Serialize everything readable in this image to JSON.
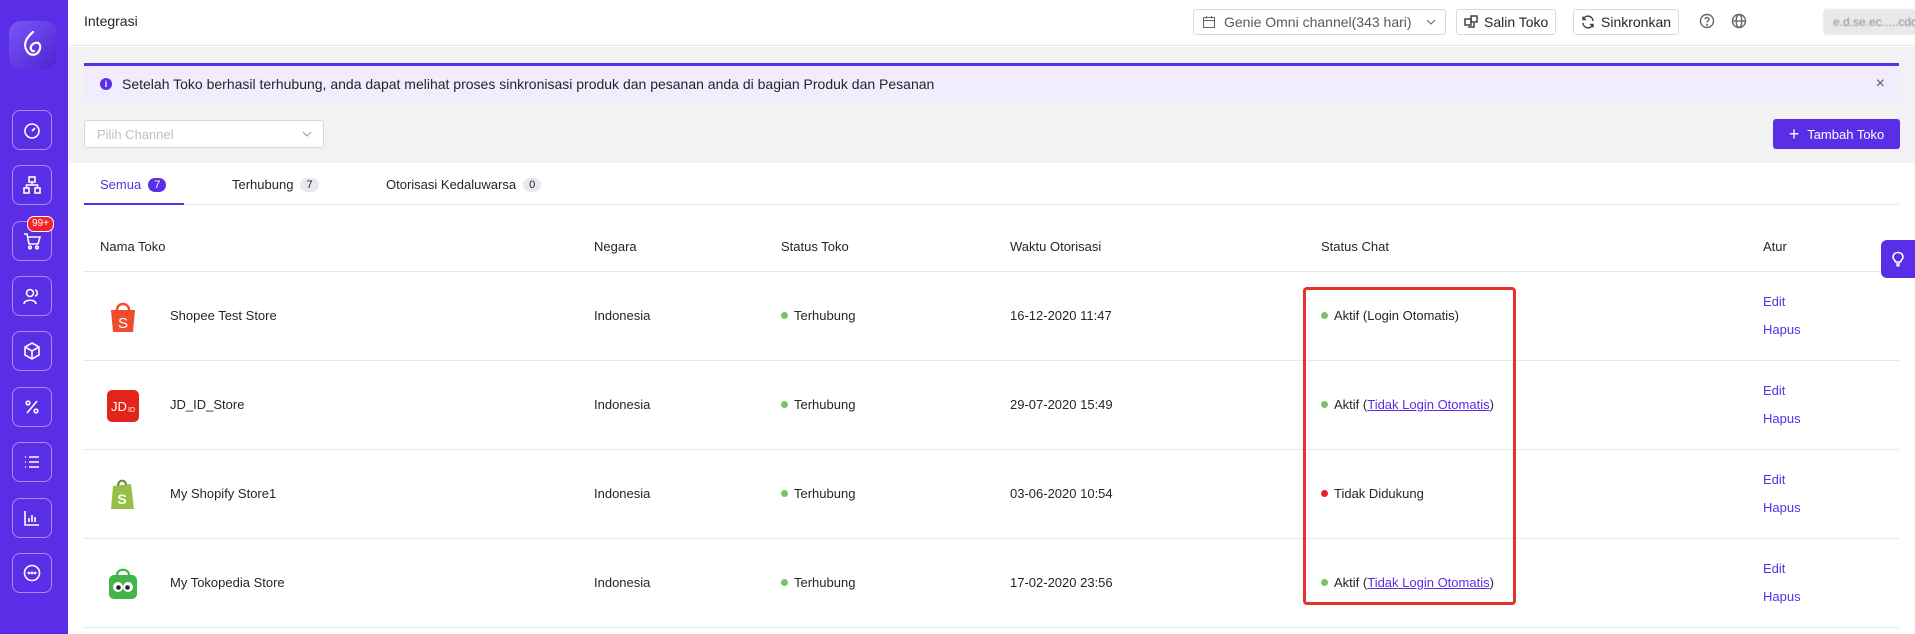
{
  "header": {
    "title": "Integrasi",
    "store_select": "Genie Omni channel(343 hari)",
    "copy_button": "Salin Toko",
    "sync_button": "Sinkronkan",
    "user": "e.d.se.ec.....cdc"
  },
  "sidebar": {
    "cart_badge": "99+",
    "items": [
      "dashboard-icon",
      "org-chart-icon",
      "cart-icon",
      "users-icon",
      "box-icon",
      "percent-icon",
      "list-icon",
      "bar-chart-icon",
      "chat-icon"
    ]
  },
  "alert": {
    "text": "Setelah Toko berhasil terhubung, anda dapat melihat proses sinkronisasi produk dan pesanan anda di bagian Produk dan Pesanan",
    "close": "×"
  },
  "filter": {
    "channel_placeholder": "Pilih Channel",
    "add_button": "Tambah Toko",
    "add_icon": "+"
  },
  "tabs": [
    {
      "label": "Semua",
      "count": "7"
    },
    {
      "label": "Terhubung",
      "count": "7"
    },
    {
      "label": "Otorisasi Kedaluwarsa",
      "count": "0"
    }
  ],
  "table": {
    "columns": [
      "Nama Toko",
      "Negara",
      "Status Toko",
      "Waktu Otorisasi",
      "Status Chat",
      "Atur"
    ],
    "rows": [
      {
        "name": "Shopee Test Store",
        "country": "Indonesia",
        "status": "Terhubung",
        "auth_time": "16-12-2020 11:47",
        "chat_status": "Aktif (Login Otomatis)",
        "chat_link": "",
        "chat_color": "green",
        "edit": "Edit",
        "delete": "Hapus"
      },
      {
        "name": "JD_ID_Store",
        "country": "Indonesia",
        "status": "Terhubung",
        "auth_time": "29-07-2020 15:49",
        "chat_status": "Aktif (",
        "chat_link": "Tidak Login Otomatis",
        "chat_color": "green",
        "edit": "Edit",
        "delete": "Hapus"
      },
      {
        "name": "My Shopify Store1",
        "country": "Indonesia",
        "status": "Terhubung",
        "auth_time": "03-06-2020 10:54",
        "chat_status": "Tidak Didukung",
        "chat_link": "",
        "chat_color": "red",
        "edit": "Edit",
        "delete": "Hapus"
      },
      {
        "name": "My Tokopedia Store",
        "country": "Indonesia",
        "status": "Terhubung",
        "auth_time": "17-02-2020 23:56",
        "chat_status": "Aktif (",
        "chat_link": "Tidak Login Otomatis",
        "chat_color": "green",
        "edit": "Edit",
        "delete": "Hapus"
      }
    ],
    "close_paren": ")"
  },
  "colors": {
    "brand": "#5a2ee6",
    "highlight": "#e8332b",
    "status_green": "#7bc06b",
    "status_red": "#e8222b"
  }
}
